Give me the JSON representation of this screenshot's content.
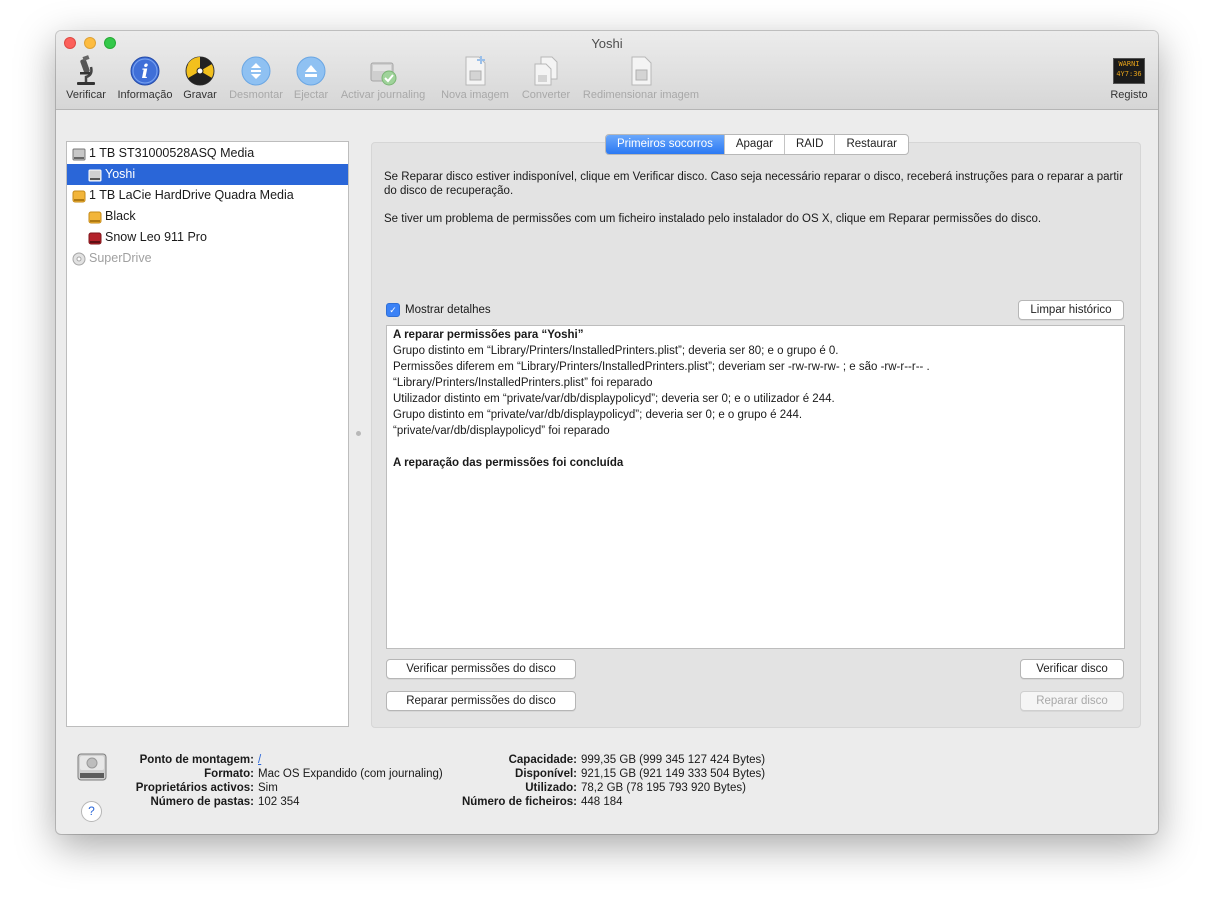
{
  "window": {
    "title": "Yoshi"
  },
  "toolbar": {
    "items": [
      {
        "label": "Verificar",
        "icon": "microscope-icon",
        "enabled": true
      },
      {
        "label": "Informação",
        "icon": "info-icon",
        "enabled": true
      },
      {
        "label": "Gravar",
        "icon": "burn-icon",
        "enabled": true
      },
      {
        "label": "Desmontar",
        "icon": "unmount-icon",
        "enabled": false
      },
      {
        "label": "Ejectar",
        "icon": "eject-icon",
        "enabled": false
      },
      {
        "label": "Activar journaling",
        "icon": "journaling-icon",
        "enabled": false
      },
      {
        "label": "Nova imagem",
        "icon": "new-image-icon",
        "enabled": false
      },
      {
        "label": "Converter",
        "icon": "convert-icon",
        "enabled": false
      },
      {
        "label": "Redimensionar imagem",
        "icon": "resize-image-icon",
        "enabled": false
      }
    ],
    "registo": {
      "label": "Registo",
      "icon": "log-icon",
      "icon_text": "WARNI 4Y7:36"
    }
  },
  "sidebar": {
    "items": [
      {
        "label": "1 TB ST31000528ASQ Media",
        "icon": "internal-disk-icon",
        "level": 0,
        "selected": false,
        "dim": false
      },
      {
        "label": "Yoshi",
        "icon": "volume-icon",
        "level": 1,
        "selected": true,
        "dim": false
      },
      {
        "label": "1 TB LaCie HardDrive Quadra Media",
        "icon": "external-disk-icon",
        "level": 0,
        "selected": false,
        "dim": false
      },
      {
        "label": "Black",
        "icon": "external-volume-icon",
        "level": 1,
        "selected": false,
        "dim": false
      },
      {
        "label": "Snow Leo 911 Pro",
        "icon": "red-volume-icon",
        "level": 1,
        "selected": false,
        "dim": false
      },
      {
        "label": "SuperDrive",
        "icon": "optical-drive-icon",
        "level": 0,
        "selected": false,
        "dim": true
      }
    ]
  },
  "tabs": [
    {
      "label": "Primeiros socorros",
      "active": true
    },
    {
      "label": "Apagar",
      "active": false
    },
    {
      "label": "RAID",
      "active": false
    },
    {
      "label": "Restaurar",
      "active": false
    }
  ],
  "first_aid": {
    "info1": "Se Reparar disco estiver indisponível, clique em Verificar disco. Caso seja necessário reparar o disco, receberá instruções para o reparar a partir do disco de recuperação.",
    "info2": "Se tiver um problema de permissões com um ficheiro instalado pelo instalador do OS X, clique em Reparar permissões do disco.",
    "show_details_label": "Mostrar detalhes",
    "show_details_checked": true,
    "clear_history_label": "Limpar histórico",
    "log": [
      {
        "text": "A reparar permissões para “Yoshi”",
        "bold": true
      },
      {
        "text": "Grupo distinto em “Library/Printers/InstalledPrinters.plist”; deveria ser 80; e o grupo é 0.",
        "bold": false
      },
      {
        "text": "Permissões diferem em “Library/Printers/InstalledPrinters.plist”; deveriam ser -rw-rw-rw- ; e são -rw-r--r-- .",
        "bold": false
      },
      {
        "text": "“Library/Printers/InstalledPrinters.plist” foi reparado",
        "bold": false
      },
      {
        "text": "Utilizador distinto em “private/var/db/displaypolicyd”; deveria ser 0; e o utilizador é 244.",
        "bold": false
      },
      {
        "text": "Grupo distinto em “private/var/db/displaypolicyd”; deveria ser 0; e o grupo é 244.",
        "bold": false
      },
      {
        "text": "“private/var/db/displaypolicyd” foi reparado",
        "bold": false
      },
      {
        "text": "",
        "bold": false
      },
      {
        "text": "A reparação das permissões foi concluída",
        "bold": true
      }
    ],
    "buttons": {
      "verify_permissions": "Verificar permissões do disco",
      "repair_permissions": "Reparar permissões do disco",
      "verify_disk": "Verificar disco",
      "repair_disk": "Reparar disco",
      "repair_disk_enabled": false
    }
  },
  "info": {
    "left": [
      {
        "key": "Ponto de montagem:",
        "value": "/",
        "link": true
      },
      {
        "key": "Formato:",
        "value": "Mac OS Expandido (com journaling)",
        "link": false
      },
      {
        "key": "Proprietários activos:",
        "value": "Sim",
        "link": false
      },
      {
        "key": "Número de pastas:",
        "value": "102 354",
        "link": false
      }
    ],
    "right": [
      {
        "key": "Capacidade:",
        "value": "999,35 GB (999 345 127 424 Bytes)"
      },
      {
        "key": "Disponível:",
        "value": "921,15 GB (921 149 333 504 Bytes)"
      },
      {
        "key": "Utilizado:",
        "value": "78,2 GB (78 195 793 920 Bytes)"
      },
      {
        "key": "Número de ficheiros:",
        "value": "448 184"
      }
    ],
    "help_label": "?"
  },
  "colors": {
    "selection": "#2a66d8",
    "tab_active": "#2b79f3",
    "link": "#2a66d8"
  }
}
